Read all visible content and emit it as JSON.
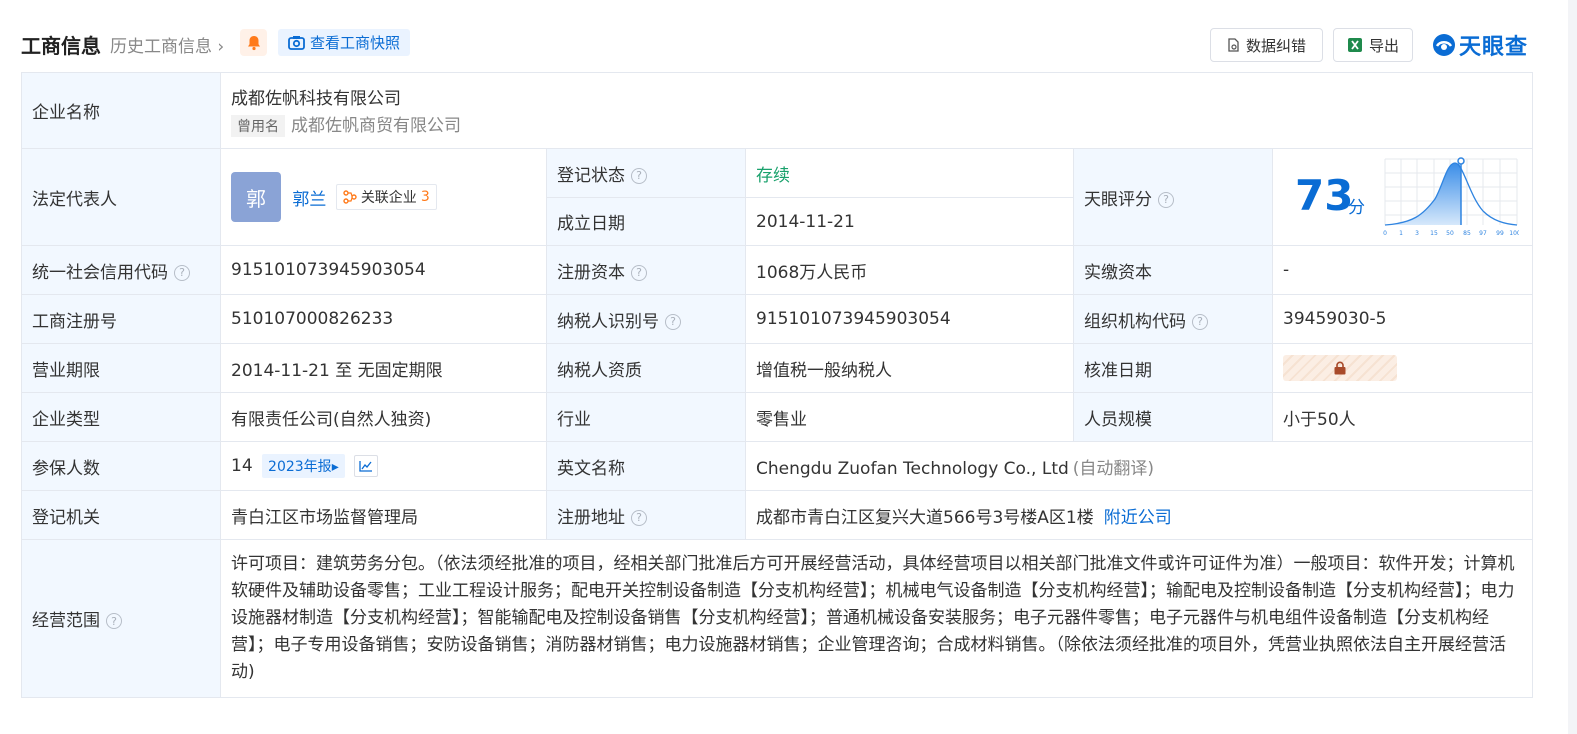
{
  "header": {
    "title": "工商信息",
    "history": "历史工商信息",
    "snapshot": "查看工商快照",
    "correct_btn": "数据纠错",
    "export_btn": "导出",
    "logo": "天眼查"
  },
  "company": {
    "name_label": "企业名称",
    "name": "成都佐帆科技有限公司",
    "used_tag": "曾用名",
    "used_name": "成都佐帆商贸有限公司"
  },
  "legal": {
    "label": "法定代表人",
    "avatar": "郭",
    "person": "郭兰",
    "assoc_label": "关联企业",
    "assoc_count": "3"
  },
  "reg_status": {
    "label": "登记状态",
    "value": "存续"
  },
  "found_date": {
    "label": "成立日期",
    "value": "2014-11-21"
  },
  "score": {
    "label": "天眼评分",
    "value": "73",
    "unit": "分",
    "axis_labels": [
      "0",
      "1",
      "3",
      "15",
      "50",
      "85",
      "97",
      "99",
      "100"
    ]
  },
  "rows": {
    "credit_code": {
      "label": "统一社会信用代码",
      "value": "915101073945903054"
    },
    "reg_capital": {
      "label": "注册资本",
      "value": "1068万人民币"
    },
    "paid_capital": {
      "label": "实缴资本",
      "value": "-"
    },
    "reg_no": {
      "label": "工商注册号",
      "value": "510107000826233"
    },
    "tax_id": {
      "label": "纳税人识别号",
      "value": "915101073945903054"
    },
    "org_code": {
      "label": "组织机构代码",
      "value": "39459030-5"
    },
    "term": {
      "label": "营业期限",
      "value": "2014-11-21 至 无固定期限"
    },
    "tax_quality": {
      "label": "纳税人资质",
      "value": "增值税一般纳税人"
    },
    "approve_date": {
      "label": "核准日期"
    },
    "company_type": {
      "label": "企业类型",
      "value": "有限责任公司(自然人独资)"
    },
    "industry": {
      "label": "行业",
      "value": "零售业"
    },
    "staff": {
      "label": "人员规模",
      "value": "小于50人"
    },
    "insured": {
      "label": "参保人数",
      "value": "14",
      "report": "2023年报"
    },
    "english": {
      "label": "英文名称",
      "value": "Chengdu Zuofan Technology Co., Ltd",
      "note": "(自动翻译)"
    },
    "authority": {
      "label": "登记机关",
      "value": "青白江区市场监督管理局"
    },
    "address": {
      "label": "注册地址",
      "value": "成都市青白江区复兴大道566号3号楼A区1楼",
      "link": "附近公司"
    },
    "scope": {
      "label": "经营范围",
      "value": "许可项目：建筑劳务分包。（依法须经批准的项目，经相关部门批准后方可开展经营活动，具体经营项目以相关部门批准文件或许可证件为准）一般项目：软件开发；计算机软硬件及辅助设备零售；工业工程设计服务；配电开关控制设备制造【分支机构经营】；机械电气设备制造【分支机构经营】；输配电及控制设备制造【分支机构经营】；电力设施器材制造【分支机构经营】；智能输配电及控制设备销售【分支机构经营】；普通机械设备安装服务；电子元器件零售；电子元器件与机电组件设备制造【分支机构经营】；电子专用设备销售；安防设备销售；消防器材销售；电力设施器材销售；企业管理咨询；合成材料销售。（除依法须经批准的项目外，凭营业执照依法自主开展经营活动)"
    }
  },
  "colors": {
    "accent": "#0a6cd4",
    "label_bg": "#f2f8ff",
    "status_green": "#19a16c",
    "count_orange": "#ff7a1a"
  }
}
